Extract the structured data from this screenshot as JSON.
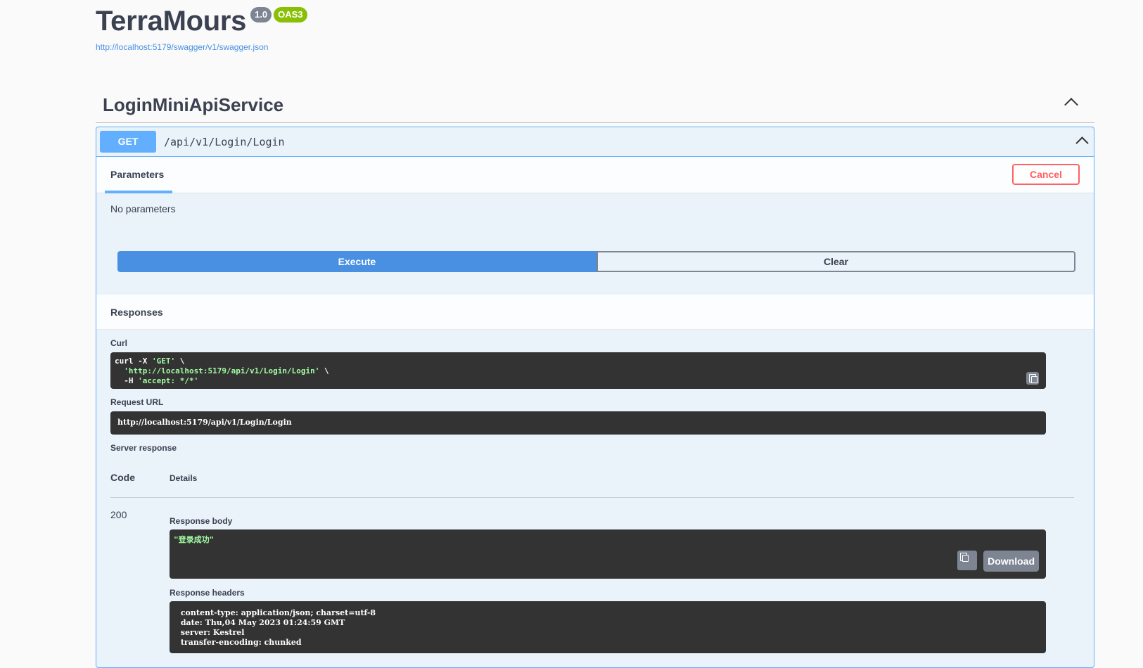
{
  "info": {
    "title": "TerraMours",
    "version_badge": "1.0",
    "oas_badge": "OAS3",
    "spec_url": "http://localhost:5179/swagger/v1/swagger.json"
  },
  "tag": {
    "name": "LoginMiniApiService"
  },
  "operation": {
    "method": "GET",
    "path": "/api/v1/Login/Login",
    "params_tab": "Parameters",
    "cancel_label": "Cancel",
    "no_params_text": "No parameters",
    "execute_label": "Execute",
    "clear_label": "Clear"
  },
  "responses": {
    "title": "Responses",
    "curl_label": "Curl",
    "curl_lines": [
      "curl -X ",
      "'GET'",
      " \\",
      "  ",
      "'http://localhost:5179/api/v1/Login/Login'",
      " \\",
      "  -H ",
      "'accept: */*'"
    ],
    "request_url_label": "Request URL",
    "request_url": "http://localhost:5179/api/v1/Login/Login",
    "server_response_label": "Server response",
    "col_code": "Code",
    "col_details": "Details",
    "status_code": "200",
    "response_body_label": "Response body",
    "response_body": "\"登录成功\"",
    "download_label": "Download",
    "response_headers_label": "Response headers",
    "headers": [
      " content-type: application/json; charset=utf-8 ",
      " date: Thu,04 May 2023 01:24:59 GMT ",
      " server: Kestrel ",
      " transfer-encoding: chunked "
    ]
  },
  "colors": {
    "get_blue": "#61affe",
    "execute_blue": "#4990e2",
    "cancel_red": "#ff6060",
    "code_bg": "#333333",
    "string_green": "#a2fca2",
    "oas_green": "#89bf04",
    "version_grey": "#7d8492"
  },
  "icons": [
    "chevron-up-icon",
    "copy-icon"
  ]
}
